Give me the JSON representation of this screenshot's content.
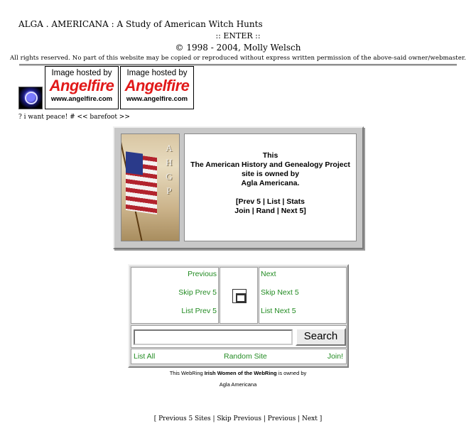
{
  "header": {
    "title": "ALGA . AMERICANA : A Study of American Witch Hunts",
    "enter": ":: ENTER ::",
    "copyright": "© 1998 - 2004, Molly Welsch",
    "rights": "All rights reserved. No part of this website may be copied or reproduced without express written permission of the above-said owner/webmaster."
  },
  "badges": [
    {
      "top": "Image hosted by",
      "brand": "Angelfire",
      "url": "www.angelfire.com"
    },
    {
      "top": "Image hosted by",
      "brand": "Angelfire",
      "url": "www.angelfire.com"
    }
  ],
  "tagline": "? i want peace! # << barefoot >>",
  "ahgp": {
    "letters": [
      "A",
      "H",
      "G",
      "P"
    ],
    "line1": "This",
    "line2": "The American History and Genealogy Project",
    "line3": "site is owned by",
    "line4": "Agla Americana.",
    "nav1_open": "[",
    "prev5": "Prev 5",
    "list": "List",
    "stats": "Stats",
    "join": "Join",
    "rand": "Rand",
    "next5": "Next 5",
    "nav2_close": "]",
    "sep": "|"
  },
  "webring": {
    "previous": "Previous",
    "skip_prev5": "Skip Prev 5",
    "list_prev5": "List Prev 5",
    "next": "Next",
    "skip_next5": "Skip Next 5",
    "list_next5": "List Next 5",
    "search_value": "",
    "search_button": "Search",
    "list_all": "List All",
    "random_site": "Random Site",
    "join": "Join!",
    "owner_pre": "This WebRing ",
    "ring_name": "Irish Women of the WebRing",
    "owner_post": " is owned by",
    "owner_name": "Agla Americana",
    "link_color": "#228b22"
  },
  "bottom_nav": "[ Previous 5 Sites | Skip Previous | Previous | Next ]"
}
